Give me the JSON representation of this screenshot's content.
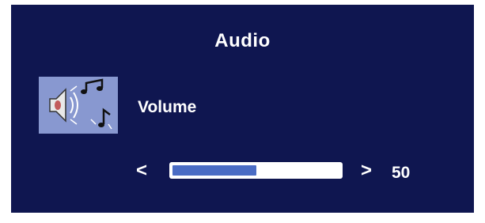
{
  "osd": {
    "title": "Audio",
    "item": {
      "icon": "speaker-music-icon",
      "label": "Volume"
    },
    "slider": {
      "decrease_glyph": "<",
      "increase_glyph": ">",
      "value": "50",
      "level_percent": 50
    }
  },
  "colors": {
    "panel_bg": "#0f1650",
    "icon_bg": "#8898d0",
    "slider_fill": "#4a6cc4",
    "text": "#ffffff"
  }
}
